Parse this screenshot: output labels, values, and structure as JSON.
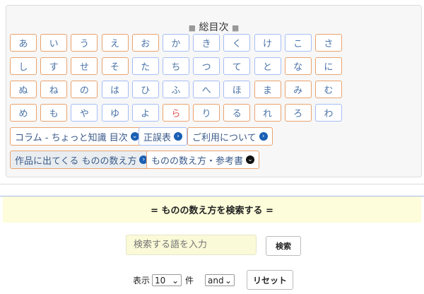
{
  "index": {
    "title": "総目次",
    "title_marker": "■",
    "kana": [
      {
        "label": "あ",
        "color": "orange"
      },
      {
        "label": "い",
        "color": "orange"
      },
      {
        "label": "う",
        "color": "orange"
      },
      {
        "label": "え",
        "color": "orange"
      },
      {
        "label": "お",
        "color": "orange"
      },
      {
        "label": "か",
        "color": "blue"
      },
      {
        "label": "き",
        "color": "blue"
      },
      {
        "label": "く",
        "color": "blue"
      },
      {
        "label": "け",
        "color": "blue"
      },
      {
        "label": "こ",
        "color": "blue"
      },
      {
        "label": "さ",
        "color": "orange"
      },
      {
        "label": "し",
        "color": "orange"
      },
      {
        "label": "す",
        "color": "orange"
      },
      {
        "label": "せ",
        "color": "orange"
      },
      {
        "label": "そ",
        "color": "orange"
      },
      {
        "label": "た",
        "color": "blue"
      },
      {
        "label": "ち",
        "color": "blue"
      },
      {
        "label": "つ",
        "color": "blue"
      },
      {
        "label": "て",
        "color": "blue"
      },
      {
        "label": "と",
        "color": "blue"
      },
      {
        "label": "な",
        "color": "orange"
      },
      {
        "label": "に",
        "color": "orange"
      },
      {
        "label": "ぬ",
        "color": "orange"
      },
      {
        "label": "ね",
        "color": "orange"
      },
      {
        "label": "の",
        "color": "orange"
      },
      {
        "label": "は",
        "color": "blue"
      },
      {
        "label": "ひ",
        "color": "blue"
      },
      {
        "label": "ふ",
        "color": "blue"
      },
      {
        "label": "へ",
        "color": "blue"
      },
      {
        "label": "ほ",
        "color": "blue"
      },
      {
        "label": "ま",
        "color": "orange"
      },
      {
        "label": "み",
        "color": "orange"
      },
      {
        "label": "む",
        "color": "orange"
      },
      {
        "label": "め",
        "color": "orange"
      },
      {
        "label": "も",
        "color": "orange"
      },
      {
        "label": "や",
        "color": "blue"
      },
      {
        "label": "ゆ",
        "color": "blue"
      },
      {
        "label": "よ",
        "color": "blue"
      },
      {
        "label": "ら",
        "color": "orange",
        "red": true
      },
      {
        "label": "り",
        "color": "orange"
      },
      {
        "label": "る",
        "color": "orange"
      },
      {
        "label": "れ",
        "color": "orange"
      },
      {
        "label": "ろ",
        "color": "orange"
      },
      {
        "label": "わ",
        "color": "blue"
      }
    ],
    "links": {
      "column": "コラム - ちょっと知識 目次",
      "errata": "正誤表",
      "usage": "ご利用について",
      "in_works": "作品に出てくる ものの数え方",
      "references": "ものの数え方・参考書"
    }
  },
  "search": {
    "heading": "= ものの数え方を検索する =",
    "placeholder": "検索する語を入力",
    "search_button": "検索",
    "show_label": "表示",
    "count_value": "10",
    "count_unit": "件",
    "mode_value": "and",
    "reset_button": "リセット"
  }
}
